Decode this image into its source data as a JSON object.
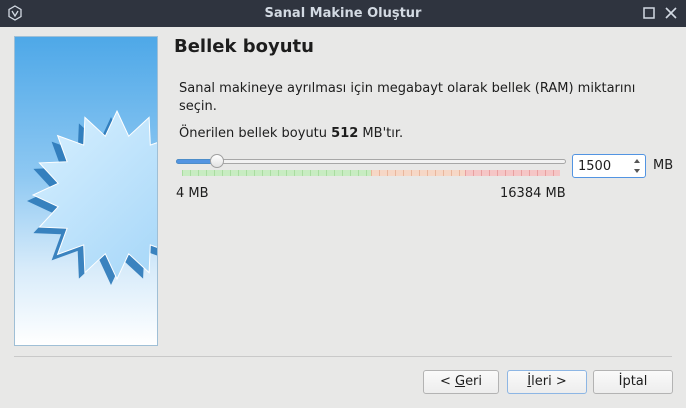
{
  "window": {
    "title": "Sanal Makine Oluştur",
    "app_icon": "virtualbox-icon",
    "controls": [
      "maximize-icon",
      "close-icon"
    ]
  },
  "page": {
    "title": "Bellek boyutu",
    "description": "Sanal makineye ayrılması için megabayt olarak bellek (RAM) miktarını seçin.",
    "recommended_prefix": "Önerilen bellek boyutu ",
    "recommended_value": "512",
    "recommended_suffix": " MB'tır."
  },
  "memory": {
    "min_label": "4 MB",
    "max_label": "16384 MB",
    "min": 4,
    "max": 16384,
    "value": "1500",
    "unit": "MB",
    "scale_zones": {
      "green_until": 8192,
      "orange_until": 12288,
      "red_until": 16384,
      "colors": {
        "green": "#c8ecc2",
        "orange": "#f6d7c6",
        "red": "#f5c6c6"
      }
    }
  },
  "buttons": {
    "back_prefix": "< ",
    "back_mnemonic": "G",
    "back_rest": "eri",
    "next_mnemonic": "İ",
    "next_rest": "leri >",
    "cancel": "İptal"
  },
  "colors": {
    "accent": "#5294e2",
    "titlebar": "#2f343f"
  }
}
